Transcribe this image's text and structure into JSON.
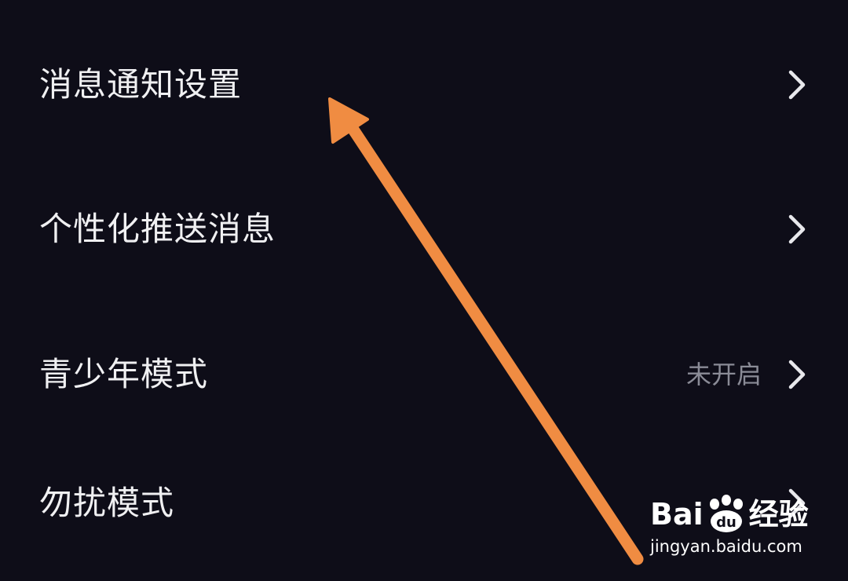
{
  "settings": {
    "items": [
      {
        "label": "消息通知设置",
        "value": ""
      },
      {
        "label": "个性化推送消息",
        "value": ""
      },
      {
        "label": "青少年模式",
        "value": "未开启"
      },
      {
        "label": "勿扰模式",
        "value": ""
      }
    ]
  },
  "colors": {
    "background": "#0e0d18",
    "text": "#f0f0f2",
    "secondary_text": "#8a8b96",
    "annotation_arrow": "#f08c42"
  },
  "icons": {
    "chevron": "chevron-right-icon",
    "arrow": "annotation-arrow-icon",
    "watermark_paw": "baidu-paw-icon"
  },
  "watermark": {
    "logo_part1": "Bai",
    "logo_part2": "经验",
    "url": "jingyan.baidu.com"
  }
}
